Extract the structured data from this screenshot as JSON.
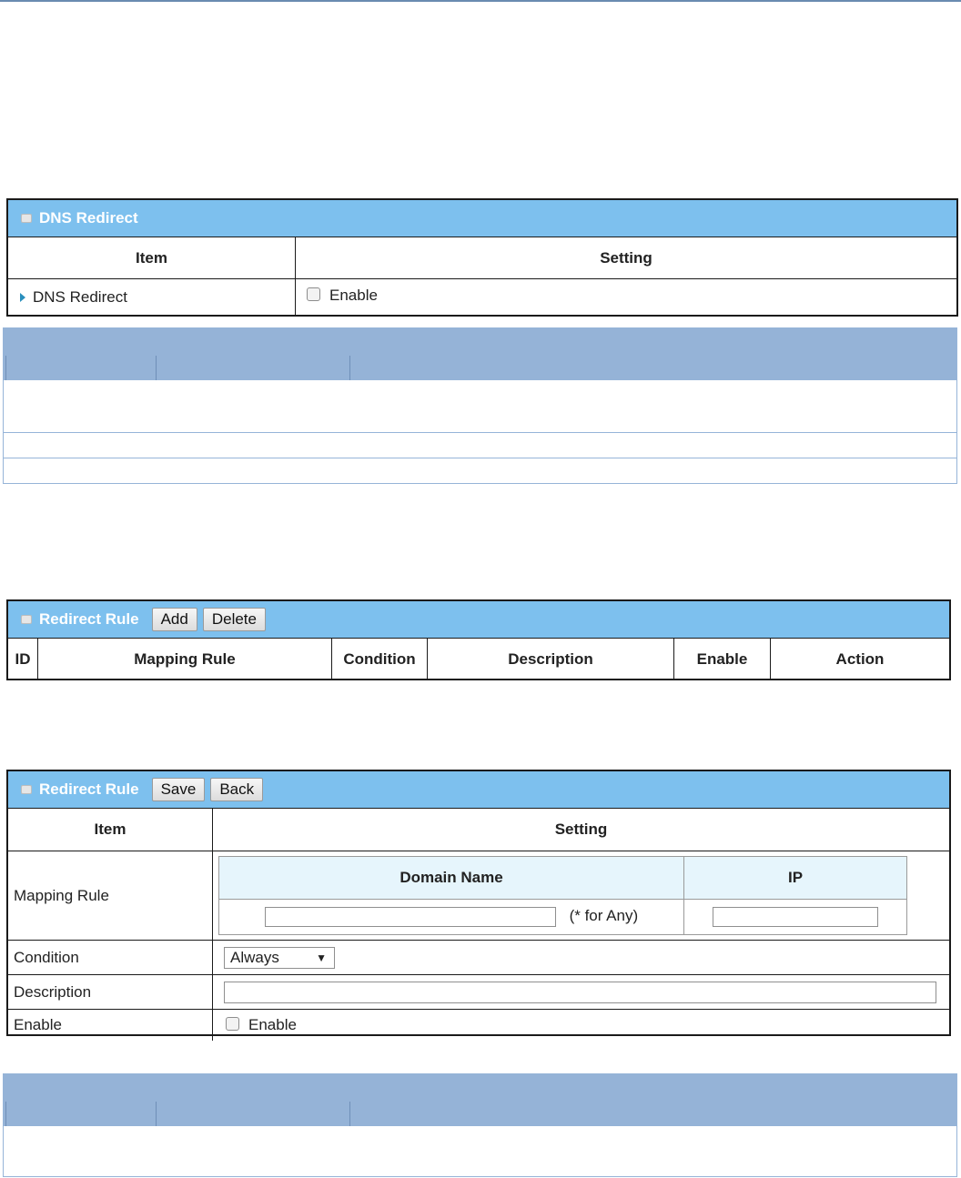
{
  "dns_redirect_panel": {
    "title": "DNS Redirect",
    "col_item": "Item",
    "col_setting": "Setting",
    "row_label": "DNS Redirect",
    "enable_label": "Enable"
  },
  "redirect_rule_list": {
    "title": "Redirect Rule",
    "add_label": "Add",
    "delete_label": "Delete",
    "columns": [
      "ID",
      "Mapping Rule",
      "Condition",
      "Description",
      "Enable",
      "Action"
    ]
  },
  "redirect_rule_edit": {
    "title": "Redirect Rule",
    "save_label": "Save",
    "back_label": "Back",
    "col_item": "Item",
    "col_setting": "Setting",
    "mapping_rule_label": "Mapping Rule",
    "domain_name_header": "Domain Name",
    "ip_header": "IP",
    "any_hint": "(* for Any)",
    "condition_label": "Condition",
    "condition_value": "Always",
    "description_label": "Description",
    "enable_row_label": "Enable",
    "enable_checkbox_label": "Enable"
  },
  "colors": {
    "panel_header": "#7dc0ee",
    "table_header_blue": "#95b3d7"
  }
}
